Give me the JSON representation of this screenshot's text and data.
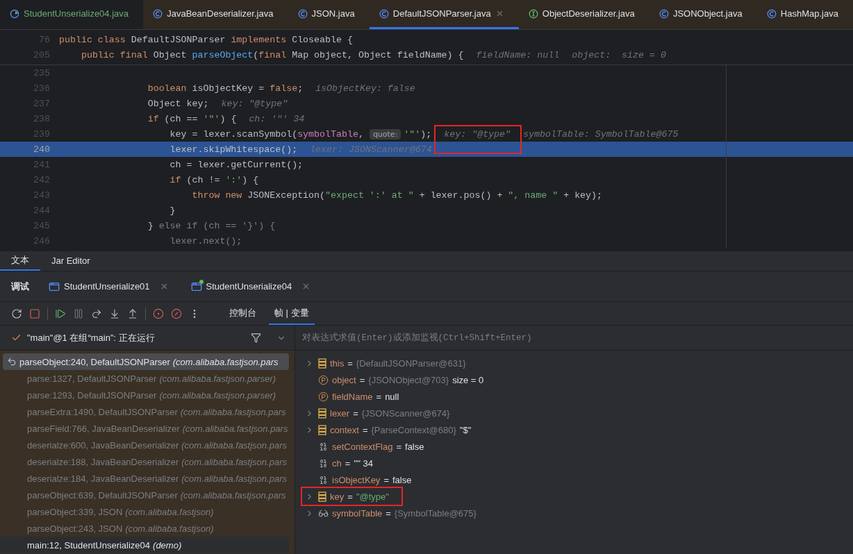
{
  "editor_tabs": [
    {
      "label": "StudentUnserialize04.java",
      "kind": "run",
      "selected": false,
      "library": false
    },
    {
      "label": "JavaBeanDeserializer.java",
      "kind": "class",
      "selected": false,
      "library": true
    },
    {
      "label": "JSON.java",
      "kind": "class",
      "selected": false,
      "library": true
    },
    {
      "label": "DefaultJSONParser.java",
      "kind": "class",
      "selected": true,
      "library": true
    },
    {
      "label": "ObjectDeserializer.java",
      "kind": "interface",
      "selected": false,
      "library": true
    },
    {
      "label": "JSONObject.java",
      "kind": "class",
      "selected": false,
      "library": true
    },
    {
      "label": "HashMap.java",
      "kind": "class",
      "selected": false,
      "library": true
    }
  ],
  "sticky_lines": [
    {
      "num": "76",
      "tokens": [
        {
          "kind": "kw",
          "text": "public class "
        },
        {
          "kind": "plain",
          "text": "DefaultJSONParser "
        },
        {
          "kind": "kw",
          "text": "implements "
        },
        {
          "kind": "plain",
          "text": "Closeable {"
        }
      ]
    },
    {
      "num": "205",
      "tokens": [
        {
          "kind": "kw",
          "text": "    public final "
        },
        {
          "kind": "plain",
          "text": "Object "
        },
        {
          "kind": "fn",
          "text": "parseObject"
        },
        {
          "kind": "plain",
          "text": "("
        },
        {
          "kind": "kw",
          "text": "final "
        },
        {
          "kind": "plain",
          "text": "Map object, Object fieldName) {"
        },
        {
          "kind": "hint",
          "text": "fieldName: null"
        },
        {
          "kind": "hint",
          "text": "object:  size = 0"
        }
      ]
    }
  ],
  "code_lines": [
    {
      "num": "235",
      "current": false
    },
    {
      "num": "236",
      "current": false,
      "tokens": [
        {
          "kind": "kw",
          "text": "                boolean "
        },
        {
          "kind": "plain",
          "text": "isObjectKey = "
        },
        {
          "kind": "kw",
          "text": "false"
        },
        {
          "kind": "plain",
          "text": ";"
        },
        {
          "kind": "hint",
          "text": "isObjectKey: false"
        }
      ]
    },
    {
      "num": "237",
      "current": false,
      "tokens": [
        {
          "kind": "plain",
          "text": "                Object key;"
        },
        {
          "kind": "hint",
          "text": "key: \"@type\""
        }
      ]
    },
    {
      "num": "238",
      "current": false,
      "tokens": [
        {
          "kind": "kw",
          "text": "                if "
        },
        {
          "kind": "plain",
          "text": "(ch == "
        },
        {
          "kind": "str",
          "text": "'\"'"
        },
        {
          "kind": "plain",
          "text": ") {"
        },
        {
          "kind": "hint",
          "text": "ch: '\"' 34"
        }
      ]
    },
    {
      "num": "239",
      "current": false,
      "tokens": [
        {
          "kind": "plain",
          "text": "                    key = lexer.scanSymbol("
        },
        {
          "kind": "param",
          "text": "symbolTable"
        },
        {
          "kind": "plain",
          "text": ", "
        },
        {
          "kind": "inlay",
          "text": "quote:"
        },
        {
          "kind": "str",
          "text": "'\"'"
        },
        {
          "kind": "plain",
          "text": ");"
        },
        {
          "kind": "marked",
          "text": "key: \"@type\""
        },
        {
          "kind": "hint",
          "text": "symbolTable: SymbolTable@675"
        }
      ]
    },
    {
      "num": "240",
      "current": true,
      "tokens": [
        {
          "kind": "plain",
          "text": "                    lexer.skipWhitespace();"
        },
        {
          "kind": "hint",
          "text": "lexer: JSONScanner@674"
        }
      ]
    },
    {
      "num": "241",
      "current": false,
      "tokens": [
        {
          "kind": "plain",
          "text": "                    ch = lexer.getCurrent();"
        }
      ]
    },
    {
      "num": "242",
      "current": false,
      "tokens": [
        {
          "kind": "kw",
          "text": "                    if "
        },
        {
          "kind": "plain",
          "text": "(ch != "
        },
        {
          "kind": "str",
          "text": "':'"
        },
        {
          "kind": "plain",
          "text": ") {"
        }
      ]
    },
    {
      "num": "243",
      "current": false,
      "tokens": [
        {
          "kind": "kw",
          "text": "                        throw new "
        },
        {
          "kind": "plain",
          "text": "JSONException("
        },
        {
          "kind": "str",
          "text": "\"expect ':' at \""
        },
        {
          "kind": "plain",
          "text": " + lexer.pos() + "
        },
        {
          "kind": "str",
          "text": "\", name \""
        },
        {
          "kind": "plain",
          "text": " + key);"
        }
      ]
    },
    {
      "num": "244",
      "current": false,
      "tokens": [
        {
          "kind": "plain",
          "text": "                    }"
        }
      ]
    },
    {
      "num": "245",
      "current": false,
      "tokens": [
        {
          "kind": "plain",
          "text": "                } "
        },
        {
          "kind": "dim",
          "text": "else if (ch == '}') {"
        }
      ]
    },
    {
      "num": "246",
      "current": false,
      "tokens": [
        {
          "kind": "dim",
          "text": "                    lexer.next();"
        }
      ]
    }
  ],
  "bottom_tabs": [
    {
      "label": "文本",
      "selected": true
    },
    {
      "label": "Jar Editor",
      "selected": false
    }
  ],
  "debug": {
    "title": "调试",
    "sessions": [
      {
        "label": "StudentUnserialize01",
        "running": false
      },
      {
        "label": "StudentUnserialize04",
        "running": true
      }
    ],
    "toolbar": [
      {
        "kind": "rerun"
      },
      {
        "kind": "stop"
      },
      {
        "kind": "resume"
      },
      {
        "kind": "pause"
      },
      {
        "kind": "step-over"
      },
      {
        "kind": "step-into"
      },
      {
        "kind": "step-out"
      },
      {
        "kind": "breakpoints"
      },
      {
        "kind": "mute"
      }
    ],
    "views": [
      {
        "label": "控制台",
        "selected": false
      },
      {
        "label": "帧 | 变量",
        "selected": true
      }
    ],
    "thread": "\"main\"@1 在组“main”: 正在运行",
    "frames": [
      {
        "method": "parseObject:240, DefaultJSONParser",
        "package": "(com.alibaba.fastjson.pars",
        "selected": true,
        "library": true
      },
      {
        "method": "parse:1327, DefaultJSONParser",
        "package": "(com.alibaba.fastjson.parser)",
        "selected": false,
        "library": true
      },
      {
        "method": "parse:1293, DefaultJSONParser",
        "package": "(com.alibaba.fastjson.parser)",
        "selected": false,
        "library": true
      },
      {
        "method": "parseExtra:1490, DefaultJSONParser",
        "package": "(com.alibaba.fastjson.pars",
        "selected": false,
        "library": true
      },
      {
        "method": "parseField:766, JavaBeanDeserializer",
        "package": "(com.alibaba.fastjson.pars",
        "selected": false,
        "library": true
      },
      {
        "method": "deserialze:600, JavaBeanDeserializer",
        "package": "(com.alibaba.fastjson.pars",
        "selected": false,
        "library": true
      },
      {
        "method": "deserialze:188, JavaBeanDeserializer",
        "package": "(com.alibaba.fastjson.pars",
        "selected": false,
        "library": true
      },
      {
        "method": "deserialze:184, JavaBeanDeserializer",
        "package": "(com.alibaba.fastjson.pars",
        "selected": false,
        "library": true
      },
      {
        "method": "parseObject:639, DefaultJSONParser",
        "package": "(com.alibaba.fastjson.pars",
        "selected": false,
        "library": true
      },
      {
        "method": "parseObject:339, JSON",
        "package": "(com.alibaba.fastjson)",
        "selected": false,
        "library": true
      },
      {
        "method": "parseObject:243, JSON",
        "package": "(com.alibaba.fastjson)",
        "selected": false,
        "library": true
      },
      {
        "method": "main:12, StudentUnserialize04",
        "package": "(demo)",
        "selected": false,
        "library": false
      }
    ],
    "eval_placeholder": "对表达式求值(Enter)或添加监视(Ctrl+Shift+Enter)",
    "variables": [
      {
        "kind": "field",
        "expandable": true,
        "name": "this",
        "op": "=",
        "value": [
          {
            "kind": "ref",
            "text": "{DefaultJSONParser@631}"
          }
        ],
        "marked": false
      },
      {
        "kind": "param",
        "expandable": false,
        "name": "object",
        "op": "=",
        "value": [
          {
            "kind": "ref",
            "text": "{JSONObject@703}"
          },
          {
            "kind": "plain",
            "text": "size = 0"
          }
        ],
        "marked": false
      },
      {
        "kind": "param",
        "expandable": false,
        "name": "fieldName",
        "op": "=",
        "value": [
          {
            "kind": "plain",
            "text": "null"
          }
        ],
        "marked": false
      },
      {
        "kind": "field",
        "expandable": true,
        "name": "lexer",
        "op": "=",
        "value": [
          {
            "kind": "ref",
            "text": "{JSONScanner@674}"
          }
        ],
        "marked": false
      },
      {
        "kind": "field",
        "expandable": true,
        "name": "context",
        "op": "=",
        "value": [
          {
            "kind": "ref",
            "text": "{ParseContext@680}"
          },
          {
            "kind": "plain",
            "text": "\"$\""
          }
        ],
        "marked": false
      },
      {
        "kind": "primitive",
        "expandable": false,
        "name": "setContextFlag",
        "op": "=",
        "value": [
          {
            "kind": "plain",
            "text": "false"
          }
        ],
        "marked": false
      },
      {
        "kind": "primitive",
        "expandable": false,
        "name": "ch",
        "op": "=",
        "value": [
          {
            "kind": "plain",
            "text": "'\"' 34"
          }
        ],
        "marked": false
      },
      {
        "kind": "primitive",
        "expandable": false,
        "name": "isObjectKey",
        "op": "=",
        "value": [
          {
            "kind": "plain",
            "text": "false"
          }
        ],
        "marked": false
      },
      {
        "kind": "field",
        "expandable": true,
        "name": "key",
        "op": "=",
        "value": [
          {
            "kind": "str",
            "text": "\"@type\""
          }
        ],
        "marked": true
      },
      {
        "kind": "watch",
        "expandable": true,
        "name": "symbolTable",
        "op": "=",
        "value": [
          {
            "kind": "ref",
            "text": "{SymbolTable@675}"
          }
        ],
        "marked": false
      }
    ]
  }
}
